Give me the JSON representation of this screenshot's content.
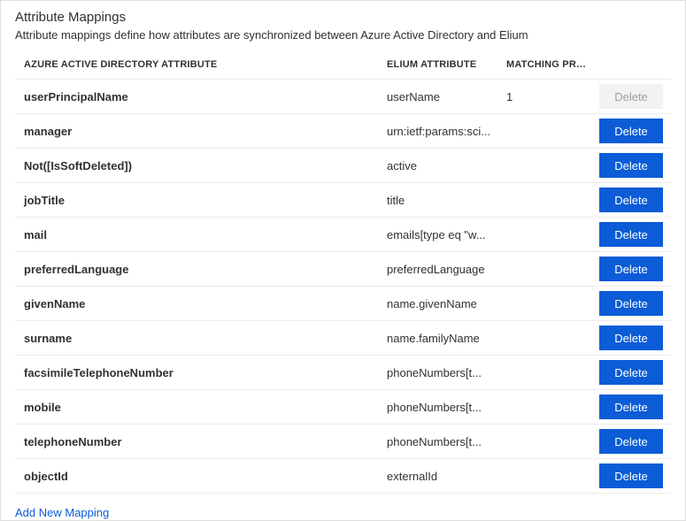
{
  "panel": {
    "title": "Attribute Mappings",
    "description": "Attribute mappings define how attributes are synchronized between Azure Active Directory and Elium"
  },
  "columns": {
    "aad": "AZURE ACTIVE DIRECTORY ATTRIBUTE",
    "elium": "ELIUM ATTRIBUTE",
    "match": "MATCHING PREC..."
  },
  "buttons": {
    "delete": "Delete"
  },
  "rows": [
    {
      "aad": "userPrincipalName",
      "elium": "userName",
      "match": "1",
      "disabled": true
    },
    {
      "aad": "manager",
      "elium": "urn:ietf:params:sci...",
      "match": "",
      "disabled": false
    },
    {
      "aad": "Not([IsSoftDeleted])",
      "elium": "active",
      "match": "",
      "disabled": false
    },
    {
      "aad": "jobTitle",
      "elium": "title",
      "match": "",
      "disabled": false
    },
    {
      "aad": "mail",
      "elium": "emails[type eq \"w...",
      "match": "",
      "disabled": false
    },
    {
      "aad": "preferredLanguage",
      "elium": "preferredLanguage",
      "match": "",
      "disabled": false
    },
    {
      "aad": "givenName",
      "elium": "name.givenName",
      "match": "",
      "disabled": false
    },
    {
      "aad": "surname",
      "elium": "name.familyName",
      "match": "",
      "disabled": false
    },
    {
      "aad": "facsimileTelephoneNumber",
      "elium": "phoneNumbers[t...",
      "match": "",
      "disabled": false
    },
    {
      "aad": "mobile",
      "elium": "phoneNumbers[t...",
      "match": "",
      "disabled": false
    },
    {
      "aad": "telephoneNumber",
      "elium": "phoneNumbers[t...",
      "match": "",
      "disabled": false
    },
    {
      "aad": "objectId",
      "elium": "externalId",
      "match": "",
      "disabled": false
    }
  ],
  "addLink": "Add New Mapping"
}
